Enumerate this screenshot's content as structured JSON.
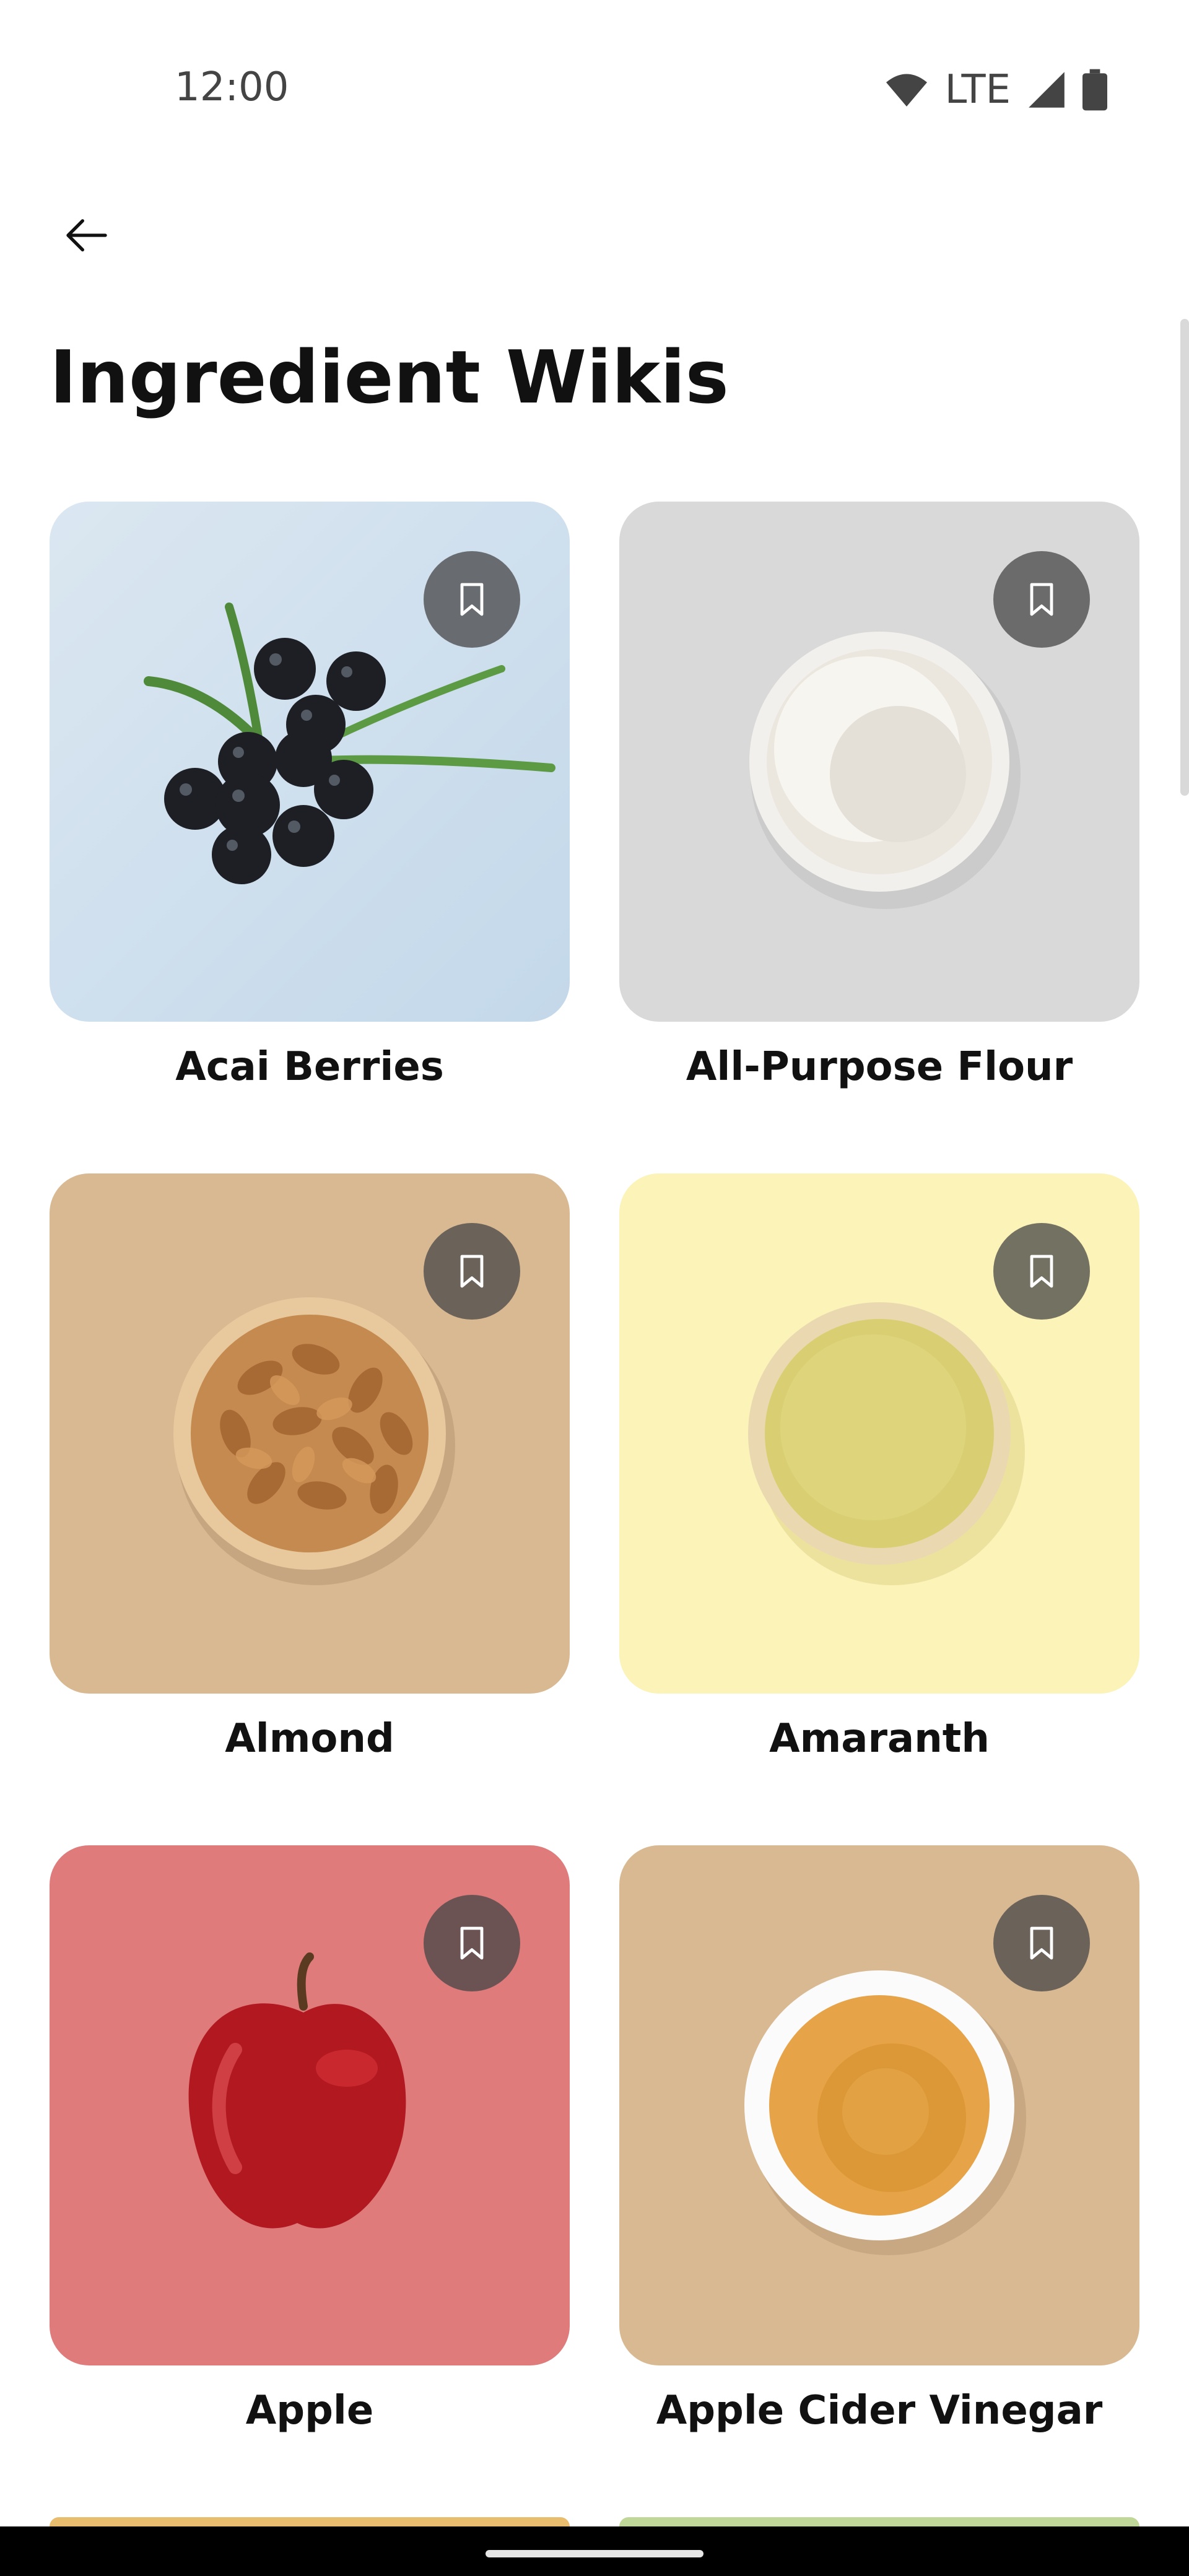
{
  "status_bar": {
    "time": "12:00",
    "network": "LTE",
    "icons": [
      "wifi-icon",
      "signal-icon",
      "battery-icon"
    ]
  },
  "header": {
    "back_icon": "arrow-left-icon",
    "title": "Ingredient Wikis"
  },
  "ingredients": [
    {
      "name": "Acai Berries",
      "bg": "#cfe1ee",
      "image": "acai-berries-image"
    },
    {
      "name": "All-Purpose Flour",
      "bg": "#d9d9d9",
      "image": "flour-bowl-image"
    },
    {
      "name": "Almond",
      "bg": "#d9b992",
      "image": "almond-bowl-image"
    },
    {
      "name": "Amaranth",
      "bg": "#fbf3b7",
      "image": "amaranth-bowl-image"
    },
    {
      "name": "Apple",
      "bg": "#df7b7b",
      "image": "apple-image"
    },
    {
      "name": "Apple Cider Vinegar",
      "bg": "#d9b992",
      "image": "vinegar-bowl-image"
    }
  ],
  "colors": {
    "text": "#111111",
    "bookmark_bg": "#464646",
    "nav_bar": "#000000"
  }
}
